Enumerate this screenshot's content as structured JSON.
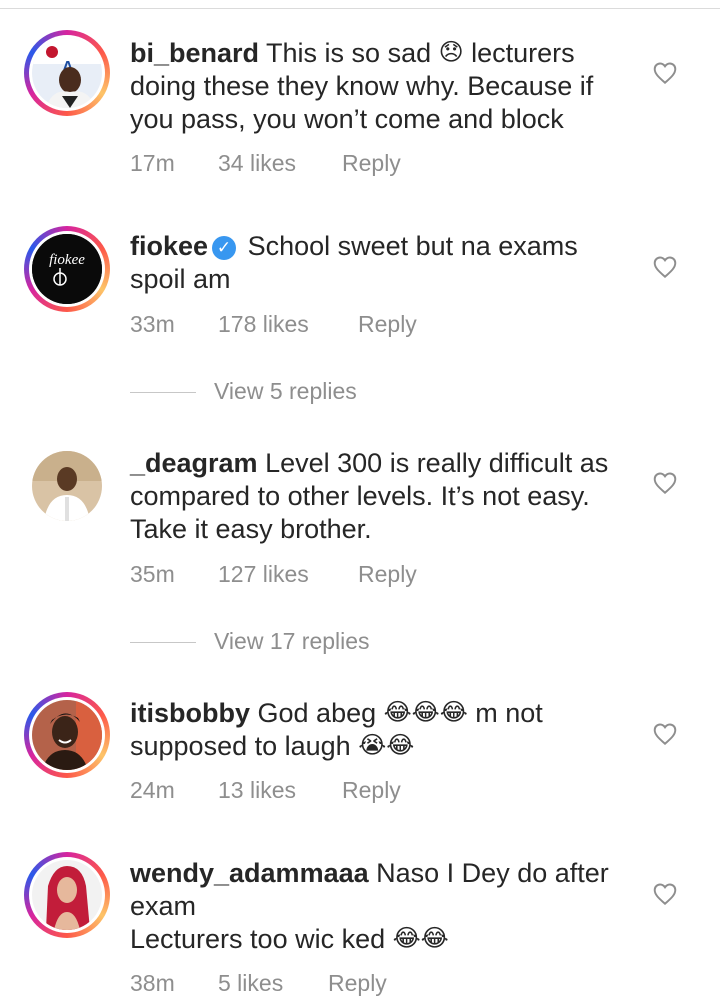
{
  "comments": [
    {
      "username": "bi_benard",
      "text_parts": [
        "This is so sad ",
        " lecturers doing these they know why. Because if you pass, you won’t come and block"
      ],
      "emoji": "😞",
      "time": "17m",
      "likes": "34 likes",
      "reply": "Reply"
    },
    {
      "username": "fiokee",
      "verified": true,
      "avatar_text": "fiokee",
      "text": "School sweet but na exams spoil am",
      "time": "33m",
      "likes": "178 likes",
      "reply": "Reply",
      "view_replies": "View 5 replies"
    },
    {
      "username": "_deagram",
      "text": "Level 300 is really difficult as compared to other levels. It’s not easy. Take it easy brother.",
      "time": "35m",
      "likes": "127 likes",
      "reply": "Reply",
      "view_replies": "View 17 replies"
    },
    {
      "username": "itisbobby",
      "text_parts": [
        "God abeg ",
        " m not supposed to laugh "
      ],
      "emoji_a": "😂😂😂",
      "emoji_b": "😭😂",
      "time": "24m",
      "likes": "13 likes",
      "reply": "Reply"
    },
    {
      "username": "wendy_adammaaa",
      "text_line1": "Naso I Dey do after exam",
      "text_line2": "Lecturers too wic ked ",
      "emoji": "😂😂",
      "time": "38m",
      "likes": "5 likes",
      "reply": "Reply"
    }
  ],
  "icons": {
    "like": "heart-outline-icon"
  },
  "colors": {
    "text": "#262626",
    "meta": "#8e8e8e",
    "verified": "#3897f0"
  }
}
